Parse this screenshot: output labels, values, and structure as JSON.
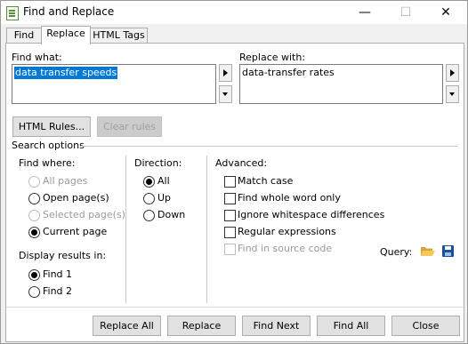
{
  "window": {
    "title": "Find and Replace",
    "controls": {
      "minimize": "—",
      "maximize": "☐",
      "close": "✕"
    }
  },
  "tabs": [
    "Find",
    "Replace",
    "HTML Tags"
  ],
  "find": {
    "label": "Find what:",
    "value": "data transfer speeds"
  },
  "replace": {
    "label": "Replace with:",
    "value": "data-transfer rates"
  },
  "buttons": {
    "html_rules": "HTML Rules...",
    "clear_rules": "Clear rules"
  },
  "search_options": {
    "label": "Search options",
    "find_where": {
      "label": "Find where:",
      "options": [
        "All pages",
        "Open page(s)",
        "Selected page(s)",
        "Current page"
      ],
      "selected": "Current page",
      "disabled": [
        "All pages",
        "Selected page(s)"
      ]
    },
    "display_results": {
      "label": "Display results in:",
      "options": [
        "Find 1",
        "Find 2"
      ],
      "selected": "Find 1"
    },
    "direction": {
      "label": "Direction:",
      "options": [
        "All",
        "Up",
        "Down"
      ],
      "selected": "All"
    },
    "advanced": {
      "label": "Advanced:",
      "options": [
        "Match case",
        "Find whole word only",
        "Ignore whitespace differences",
        "Regular expressions",
        "Find in source code"
      ],
      "disabled": [
        "Find in source code"
      ]
    },
    "query_label": "Query:"
  },
  "footer": {
    "replace_all": "Replace All",
    "replace": "Replace",
    "find_next": "Find Next",
    "find_all": "Find All",
    "close": "Close"
  },
  "icons": {
    "folder": "open-folder-icon",
    "save": "save-icon"
  }
}
